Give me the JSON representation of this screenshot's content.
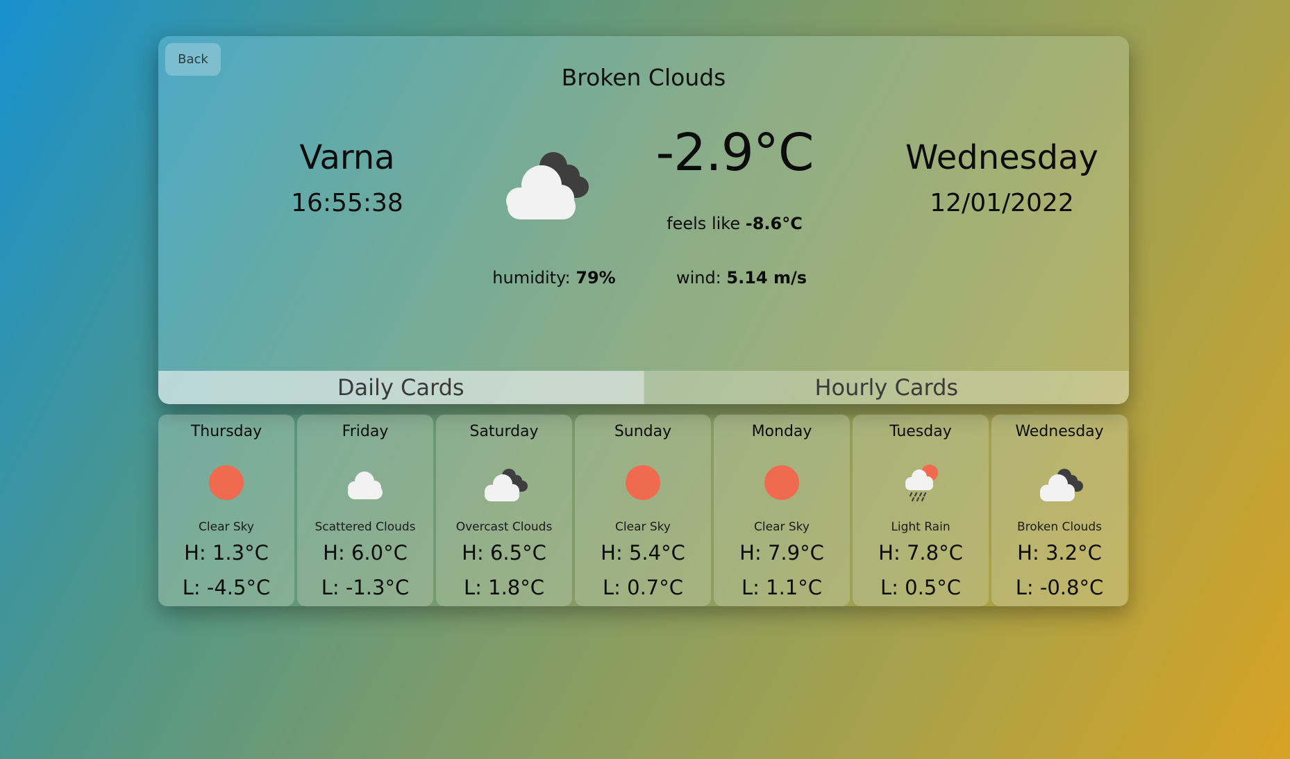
{
  "current": {
    "back_label": "Back",
    "condition": "Broken Clouds",
    "city": "Varna",
    "time": "16:55:38",
    "temperature": "-2.9°C",
    "feels_like_label": "feels like",
    "feels_like_value": "-8.6°C",
    "humidity_label": "humidity:",
    "humidity_value": "79%",
    "wind_label": "wind:",
    "wind_value": "5.14 m/s",
    "day": "Wednesday",
    "date": "12/01/2022",
    "icon": "broken-clouds-icon"
  },
  "tabs": {
    "daily_label": "Daily Cards",
    "hourly_label": "Hourly Cards",
    "active": "daily"
  },
  "colors": {
    "sun": "#ef6a4e",
    "cloud_light": "#f2f2f2",
    "cloud_dark": "#3e3e3e"
  },
  "daily": [
    {
      "day": "Thursday",
      "icon": "clear-sky-icon",
      "description": "Clear Sky",
      "high": "H: 1.3°C",
      "low": "L: -4.5°C"
    },
    {
      "day": "Friday",
      "icon": "scattered-clouds-icon",
      "description": "Scattered Clouds",
      "high": "H: 6.0°C",
      "low": "L: -1.3°C"
    },
    {
      "day": "Saturday",
      "icon": "overcast-clouds-icon",
      "description": "Overcast Clouds",
      "high": "H: 6.5°C",
      "low": "L: 1.8°C"
    },
    {
      "day": "Sunday",
      "icon": "clear-sky-icon",
      "description": "Clear Sky",
      "high": "H: 5.4°C",
      "low": "L: 0.7°C"
    },
    {
      "day": "Monday",
      "icon": "clear-sky-icon",
      "description": "Clear Sky",
      "high": "H: 7.9°C",
      "low": "L: 1.1°C"
    },
    {
      "day": "Tuesday",
      "icon": "light-rain-icon",
      "description": "Light Rain",
      "high": "H: 7.8°C",
      "low": "L: 0.5°C"
    },
    {
      "day": "Wednesday",
      "icon": "broken-clouds-icon",
      "description": "Broken Clouds",
      "high": "H: 3.2°C",
      "low": "L: -0.8°C"
    }
  ]
}
